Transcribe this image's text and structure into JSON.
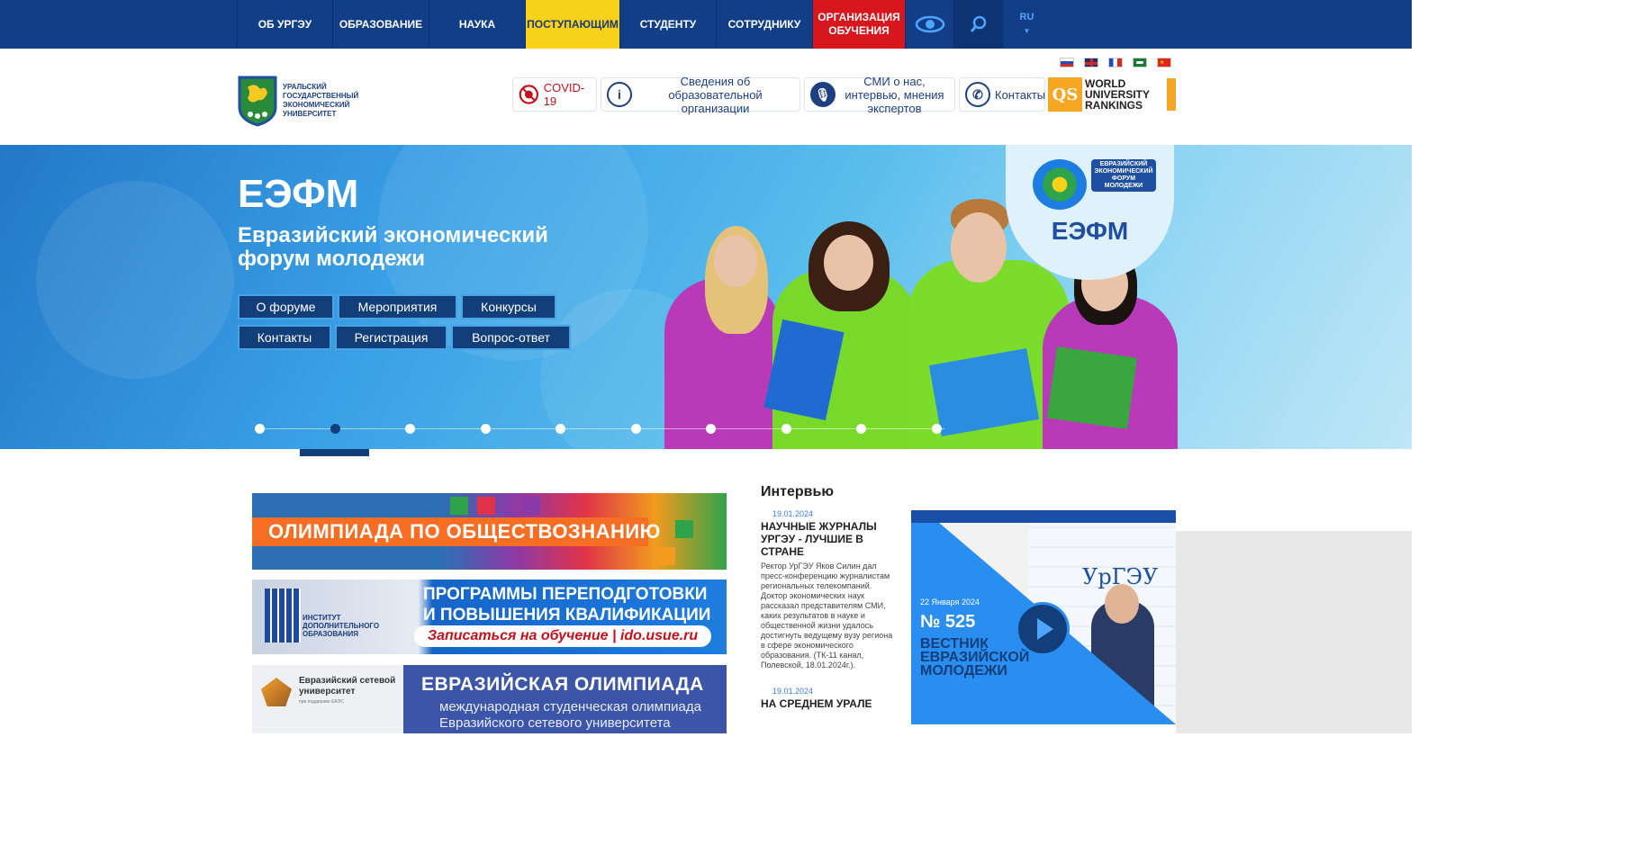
{
  "nav": {
    "items": [
      {
        "label": "ОБ УРГЭУ",
        "w": 106
      },
      {
        "label": "ОБРАЗОВАНИЕ",
        "w": 107
      },
      {
        "label": "НАУКА",
        "w": 107
      },
      {
        "label": "ПОСТУПАЮЩИМ",
        "w": 105
      },
      {
        "label": "СТУДЕНТУ",
        "w": 107
      },
      {
        "label": "СОТРУДНИКУ",
        "w": 107
      },
      {
        "label": "ОРГАНИЗАЦИЯ ОБУЧЕНИЯ",
        "w": 103
      }
    ],
    "lang": "RU"
  },
  "header": {
    "logo_text": "Уральский государственный экономический университет",
    "covid": "COVID-19",
    "info_label": "Сведения об образовательной организации",
    "smi_label": "СМИ о нас, интервью, мнения экспертов",
    "contacts_label": "Контакты",
    "qs_logo": "QS",
    "qs_label": "WORLD UNIVERSITY RANKINGS"
  },
  "hero": {
    "title": "ЕЭФМ",
    "subtitle": "Евразийский экономический форум молодежи",
    "buttons_row1": [
      "О форуме",
      "Мероприятия",
      "Конкурсы"
    ],
    "buttons_row2": [
      "Контакты",
      "Регистрация",
      "Вопрос-ответ"
    ],
    "badge_title": "ЕЭФМ",
    "badge_label": "ЕВРАЗИЙСКИЙ ЭКОНОМИЧЕСКИЙ ФОРУМ МОЛОДЕЖИ",
    "slide_count": 10,
    "active_slide": 2
  },
  "banners": {
    "b1_text": "ОЛИМПИАДА ПО ОБЩЕСТВОЗНАНИЮ",
    "b2_left": "Институт дополнительного образования",
    "b2_line1": "ПРОГРАММЫ ПЕРЕПОДГОТОВКИ",
    "b2_line2": "И ПОВЫШЕНИЯ КВАЛИФИКАЦИИ",
    "b2_pill": "Записаться на обучение  |  ido.usue.ru",
    "b3_left": "Евразийский сетевой университет",
    "b3_left_small": "при поддержке ЕАЭС",
    "b3_title": "ЕВРАЗИЙСКАЯ ОЛИМПИАДА",
    "b3_line1": "международная студенческая олимпиада",
    "b3_line2": "Евразийского сетевого университета"
  },
  "interview": {
    "heading": "Интервью",
    "items": [
      {
        "date": "19.01.2024",
        "title": "НАУЧНЫЕ ЖУРНАЛЫ УРГЭУ - ЛУЧШИЕ В СТРАНЕ",
        "body": "Ректор УрГЭУ Яков Силин дал пресс-конференцию журналистам региональных телекомпаний. Доктор экономических наук рассказал представителям СМИ, каких результатов в науке и общественной жизни удалось достигнуть ведущему вузу региона в сфере экономического образования. (ТК-11 канал, Полевской, 18.01.2024г.)."
      },
      {
        "date": "19.01.2024",
        "title": "НА СРЕДНЕМ УРАЛЕ",
        "body": ""
      }
    ]
  },
  "vestnik": {
    "date": "22 Января 2024",
    "number": "№ 525",
    "title": "ВЕСТНИК ЕВРАЗИЙСКОЙ МОЛОДЕЖИ",
    "bg_text": "УрГЭУ"
  }
}
